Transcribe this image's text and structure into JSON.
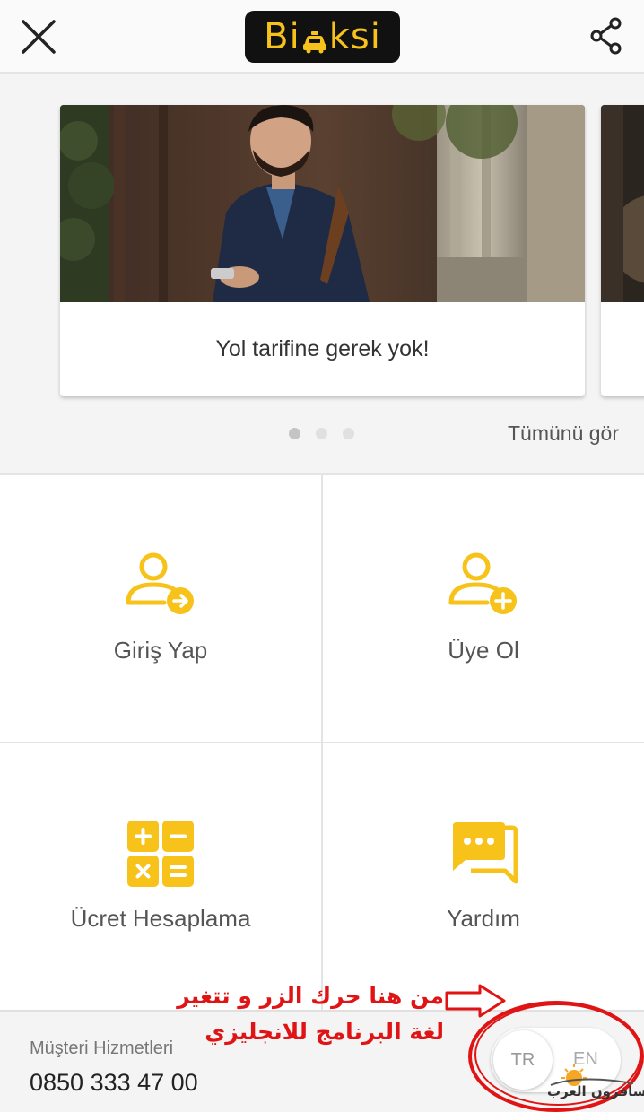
{
  "header": {
    "logo_prefix": "Bi",
    "logo_suffix": "ksi",
    "logo_full": "BiTaksi"
  },
  "carousel": {
    "cards": [
      {
        "caption": "Yol tarifine gerek yok!"
      }
    ],
    "dot_count": 3,
    "active_dot": 1,
    "see_all": "Tümünü gör"
  },
  "grid": {
    "login": {
      "label": "Giriş Yap",
      "icon": "user-login-icon"
    },
    "signup": {
      "label": "Üye Ol",
      "icon": "user-add-icon"
    },
    "fare": {
      "label": "Ücret Hesaplama",
      "icon": "calculator-icon"
    },
    "help": {
      "label": "Yardım",
      "icon": "chat-bubbles-icon"
    }
  },
  "footer": {
    "customer_service_label": "Müşteri Hizmetleri",
    "phone": "0850 333 47 00",
    "lang_selected": "TR",
    "lang_other": "EN"
  },
  "annotation": {
    "line1": "من هنا حرك الزر و تتغير",
    "line2": "لغة البرنامج للانجليزي",
    "watermark": "المسافرون العرب"
  },
  "colors": {
    "accent": "#f7c31a",
    "annotation": "#e01414"
  }
}
